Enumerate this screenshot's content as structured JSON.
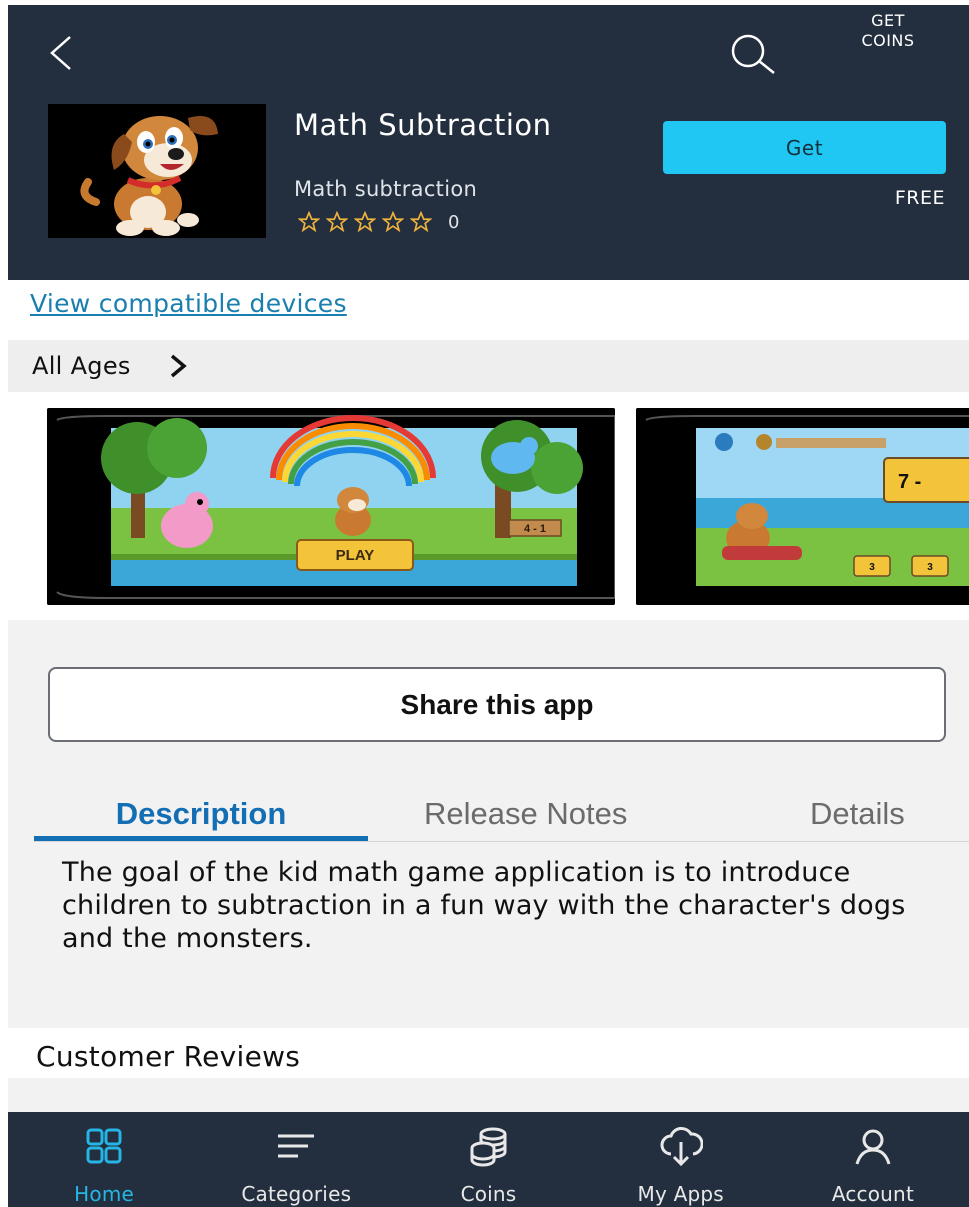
{
  "header": {
    "get_coins_line1": "GET",
    "get_coins_line2": "COINS",
    "app_title": "Math Subtraction",
    "app_subtitle": "Math subtraction",
    "rating_count": "0",
    "rating_stars_filled": 0,
    "get_button_label": "Get",
    "price": "FREE",
    "accent_color": "#1fc7f2"
  },
  "links": {
    "compatible_devices": "View compatible devices"
  },
  "age_rating": {
    "label": "All Ages"
  },
  "screenshots": [
    {
      "button_text": "PLAY",
      "sign_text": "4 - 1"
    },
    {
      "problem_text": "7 -",
      "answer_a": "3",
      "answer_b": "3"
    }
  ],
  "share": {
    "label": "Share this app"
  },
  "tabs": {
    "description": "Description",
    "release_notes": "Release Notes",
    "details": "Details"
  },
  "description_text": "The goal of the kid math game application is to introduce children to subtraction in a fun way with the character's dogs and the monsters.",
  "reviews": {
    "title": "Customer Reviews"
  },
  "bottom_nav": {
    "home": "Home",
    "categories": "Categories",
    "coins": "Coins",
    "my_apps": "My Apps",
    "account": "Account"
  }
}
